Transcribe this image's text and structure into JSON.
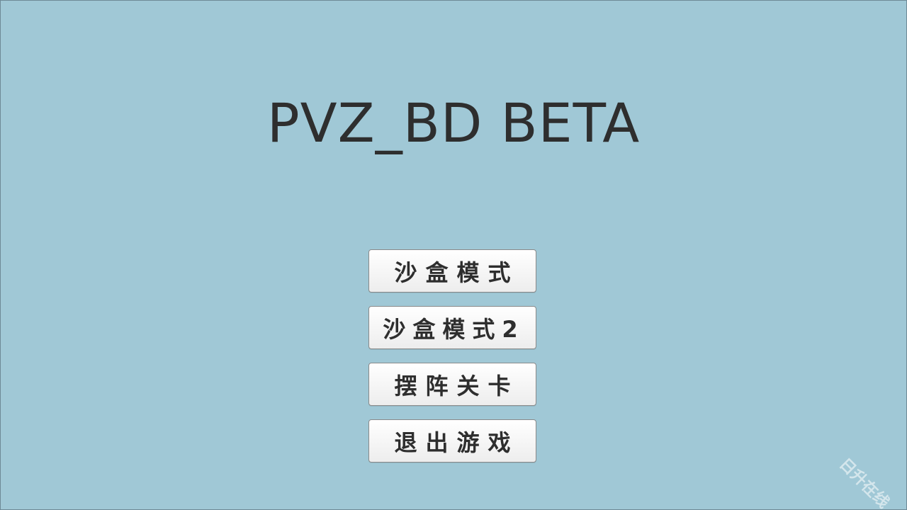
{
  "title": "PVZ_BD BETA",
  "menu": {
    "sandbox_label": "沙盒模式",
    "sandbox2_label": "沙盒模式2",
    "formation_label": "摆阵关卡",
    "quit_label": "退出游戏"
  },
  "watermark": "日升在线",
  "colors": {
    "background": "#a0c8d6",
    "title_text": "#2e2e2e",
    "button_face": "#f3f3f3"
  }
}
